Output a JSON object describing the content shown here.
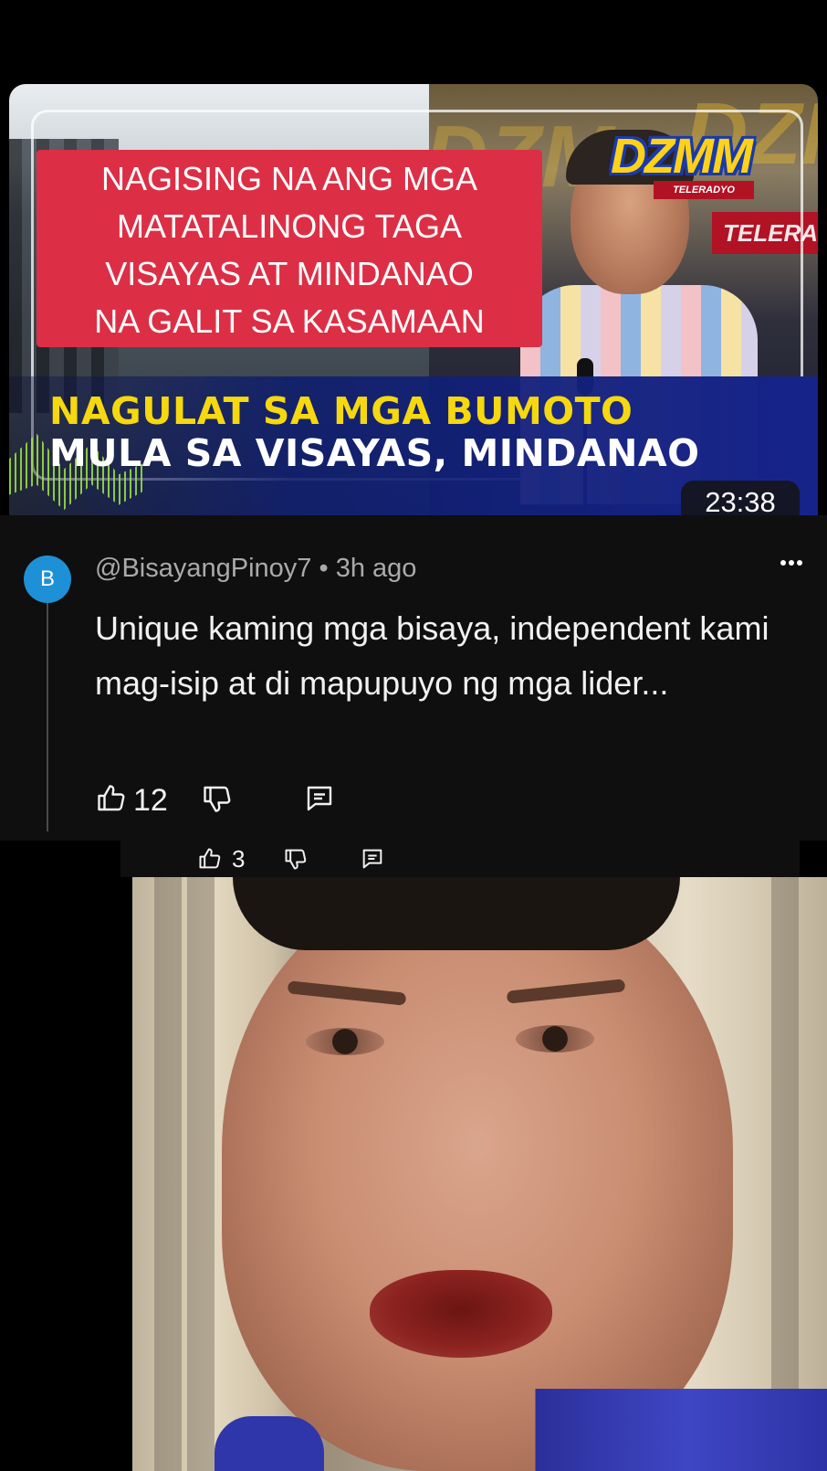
{
  "thumbnail": {
    "overlay_lines": [
      "NAGISING NA ANG MGA",
      "MATATALINONG TAGA",
      "VISAYAS AT MINDANAO",
      "NA GALIT SA KASAMAAN"
    ],
    "headline_line1": "NAGULAT SA MGA BUMOTO",
    "headline_line2": "MULA SA VISAYAS, MINDANAO",
    "logo_text": "DZMM",
    "logo_sub": "TELERADYO",
    "bg_wordmark": "DZM",
    "tele_bar": "TELERA",
    "duration": "23:38",
    "colors": {
      "overlay_red": "#dc2f45",
      "headline_yellow": "#f5d80f",
      "band_blue": "#16238a"
    }
  },
  "comment": {
    "avatar_letter": "B",
    "author": "@BisayangPinoy7",
    "separator": "•",
    "time": "3h ago",
    "text": "Unique kaming mga bisaya, independent kami mag-isip at di mapupuyo ng mga lider...",
    "like_count": "12",
    "colors": {
      "avatar": "#1e90d6",
      "background": "#0f0f0f"
    }
  },
  "reply": {
    "like_count": "3"
  },
  "icons": {
    "like": "thumbs-up-icon",
    "dislike": "thumbs-down-icon",
    "reply": "comment-icon",
    "more": "more-icon"
  }
}
